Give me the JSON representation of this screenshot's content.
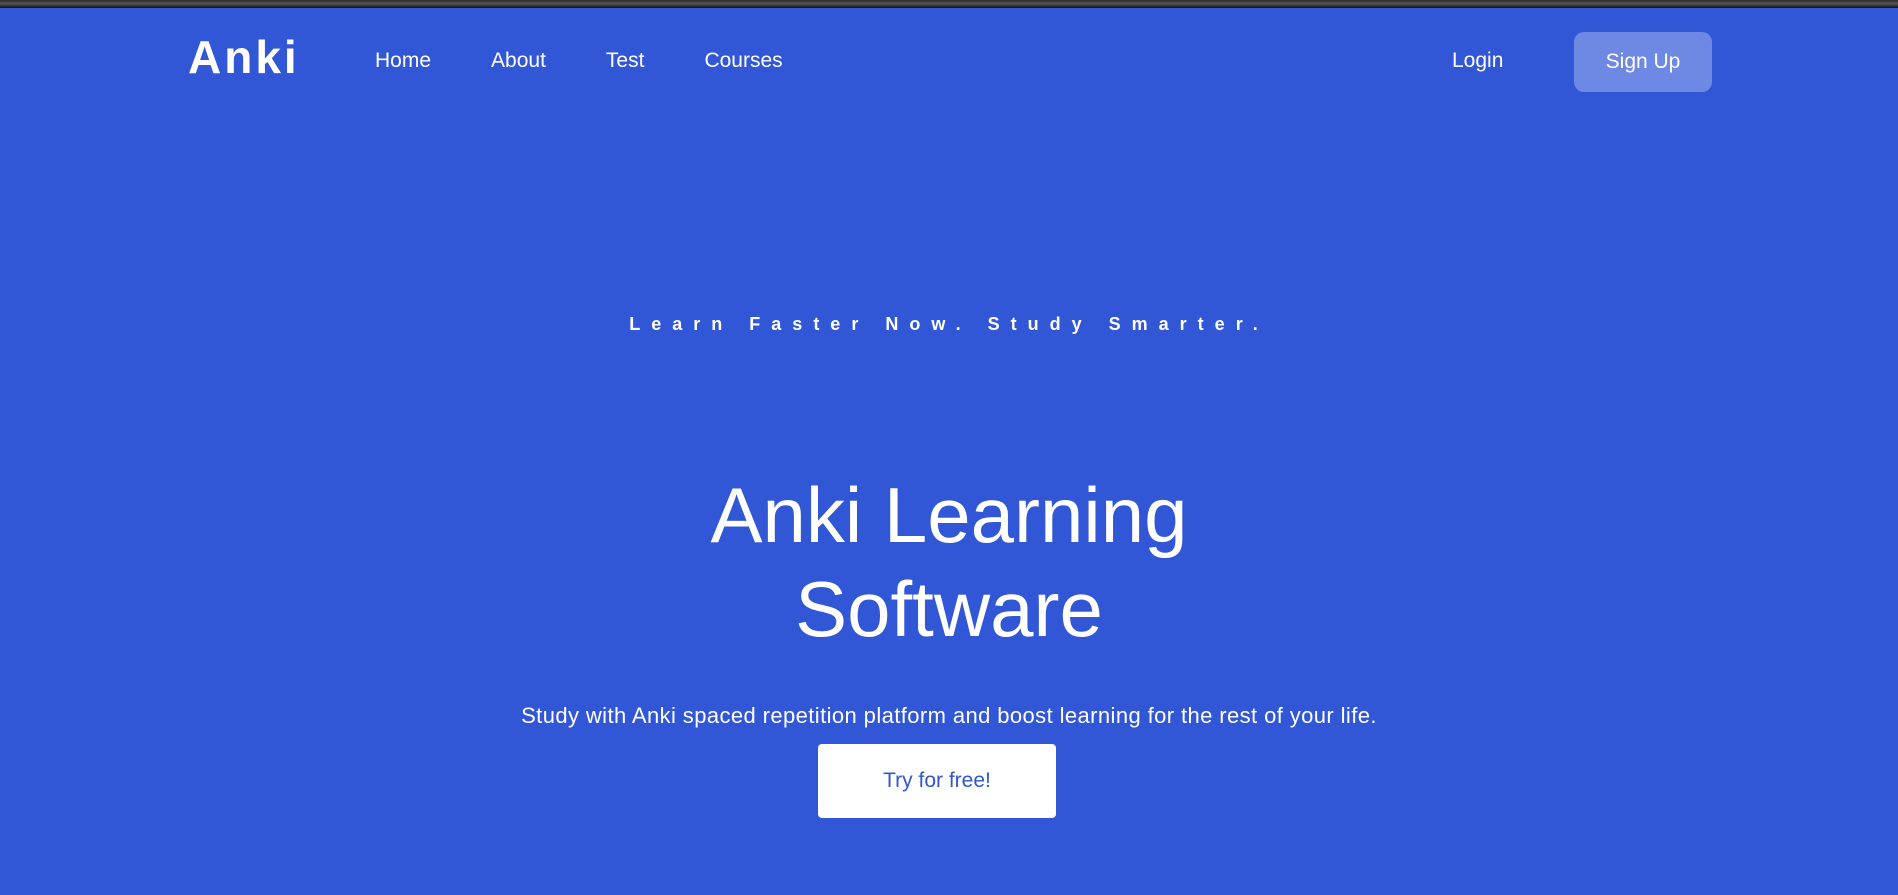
{
  "nav": {
    "logo": "Anki",
    "links": [
      "Home",
      "About",
      "Test",
      "Courses"
    ],
    "login": "Login",
    "signup": "Sign Up"
  },
  "hero": {
    "eyebrow": "Learn Faster Now. Study Smarter.",
    "title_line1": "Anki Learning",
    "title_line2": "Software",
    "subtitle": "Study with Anki spaced repetition platform and boost learning for the rest of your life.",
    "cta": "Try for free!"
  },
  "colors": {
    "background": "#3157d6",
    "button_secondary": "#6e89e3",
    "button_primary_bg": "#ffffff",
    "button_primary_text": "#2f57d2"
  }
}
